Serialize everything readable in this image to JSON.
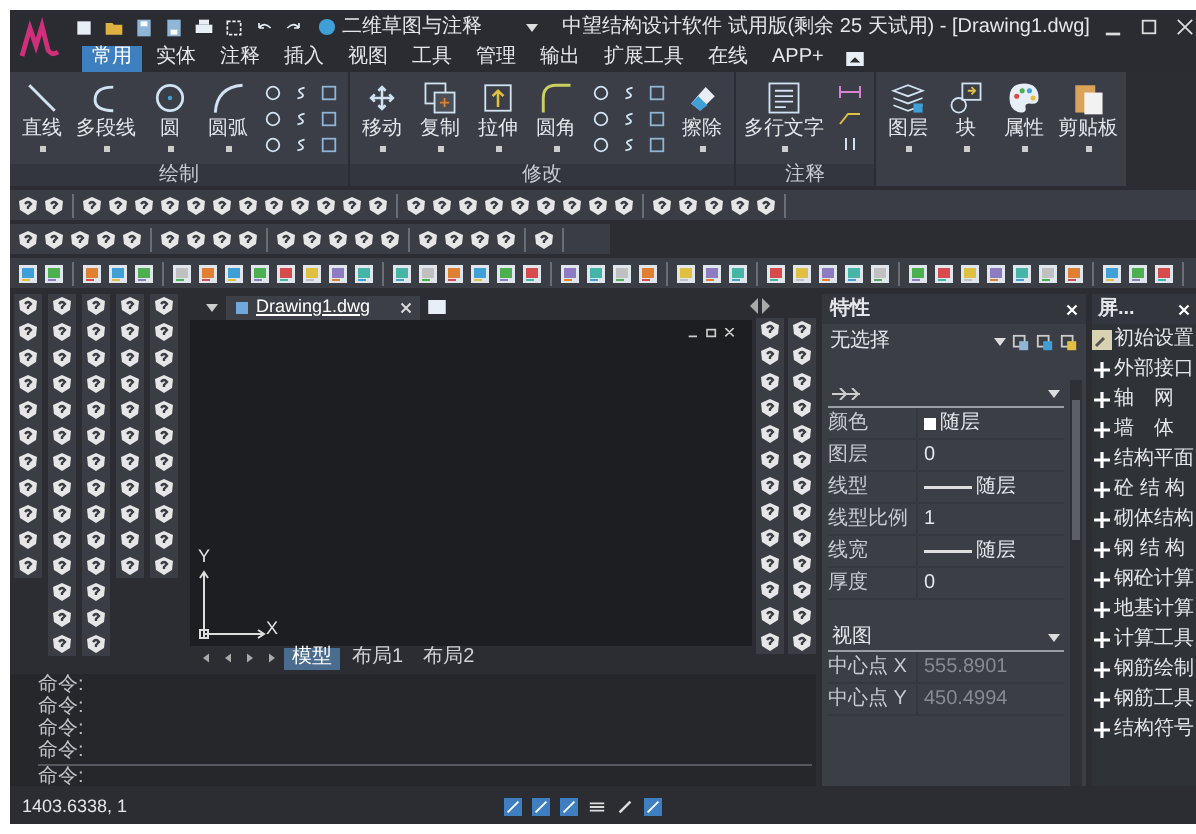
{
  "title_bar": {
    "workspace": "二维草图与注释",
    "title": "中望结构设计软件 试用版(剩余 25 天试用) - [Drawing1.dwg]"
  },
  "ribbon_tabs": [
    {
      "label": "常用",
      "selected": true
    },
    {
      "label": "实体",
      "selected": false
    },
    {
      "label": "注释",
      "selected": false
    },
    {
      "label": "插入",
      "selected": false
    },
    {
      "label": "视图",
      "selected": false
    },
    {
      "label": "工具",
      "selected": false
    },
    {
      "label": "管理",
      "selected": false
    },
    {
      "label": "输出",
      "selected": false
    },
    {
      "label": "扩展工具",
      "selected": false
    },
    {
      "label": "在线",
      "selected": false
    },
    {
      "label": "APP+",
      "selected": false
    }
  ],
  "ribbon_panels": [
    {
      "label": "绘制",
      "items": [
        {
          "kind": "large",
          "label": "直线"
        },
        {
          "kind": "large",
          "label": "多段线"
        },
        {
          "kind": "large",
          "label": "圆"
        },
        {
          "kind": "large",
          "label": "圆弧"
        },
        {
          "kind": "small_grid"
        }
      ]
    },
    {
      "label": "修改",
      "items": [
        {
          "kind": "large",
          "label": "移动"
        },
        {
          "kind": "large",
          "label": "复制"
        },
        {
          "kind": "large",
          "label": "拉伸"
        },
        {
          "kind": "large",
          "label": "圆角"
        },
        {
          "kind": "small_grid"
        },
        {
          "kind": "large",
          "label": "擦除"
        }
      ]
    },
    {
      "label": "注释",
      "items": [
        {
          "kind": "large",
          "label": "多行文字"
        },
        {
          "kind": "small_column"
        }
      ]
    },
    {
      "items": [
        {
          "kind": "large",
          "label": "图层"
        },
        {
          "kind": "large",
          "label": "块"
        },
        {
          "kind": "large",
          "label": "属性"
        },
        {
          "kind": "large",
          "label": "剪贴板"
        }
      ]
    }
  ],
  "drawing": {
    "tabs": [
      {
        "label": "Drawing1.dwg",
        "selected": true
      }
    ],
    "axis_x": "X",
    "axis_y": "Y",
    "layout_tabs": [
      {
        "label": "模型",
        "selected": true
      },
      {
        "label": "布局1",
        "selected": false
      },
      {
        "label": "布局2",
        "selected": false
      }
    ]
  },
  "command": {
    "history": [
      "命令:",
      "命令:",
      "命令:",
      "命令:"
    ],
    "prompt": "命令:"
  },
  "status_bar": {
    "coordinates": "1403.6338, 1"
  },
  "properties": {
    "title": "特性",
    "selection": "无选择",
    "sections": [
      {
        "rows": [
          {
            "name": "颜色",
            "value": "随层",
            "kind": "color",
            "disabled": false
          },
          {
            "name": "图层",
            "value": "0",
            "kind": "text",
            "disabled": false
          },
          {
            "name": "线型",
            "value": "随层",
            "kind": "line",
            "disabled": false
          },
          {
            "name": "线型比例",
            "value": "1",
            "kind": "text",
            "disabled": false
          },
          {
            "name": "线宽",
            "value": "随层",
            "kind": "line",
            "disabled": false
          },
          {
            "name": "厚度",
            "value": "0",
            "kind": "text",
            "disabled": false
          }
        ]
      },
      {
        "title": "视图",
        "rows": [
          {
            "name": "中心点 X",
            "value": "555.8901",
            "kind": "text",
            "disabled": true
          },
          {
            "name": "中心点 Y",
            "value": "450.4994",
            "kind": "text",
            "disabled": true
          }
        ]
      }
    ]
  },
  "screen_menu": {
    "title": "屏...",
    "items": [
      {
        "label": "初始设置",
        "kind": "settings"
      },
      {
        "label": "外部接口",
        "kind": "expand"
      },
      {
        "label": "轴　网",
        "kind": "expand"
      },
      {
        "label": "墙　体",
        "kind": "expand"
      },
      {
        "label": "结构平面",
        "kind": "expand"
      },
      {
        "label": "砼 结 构",
        "kind": "expand"
      },
      {
        "label": "砌体结构",
        "kind": "expand"
      },
      {
        "label": "钢 结 构",
        "kind": "expand"
      },
      {
        "label": "钢砼计算",
        "kind": "expand"
      },
      {
        "label": "地基计算",
        "kind": "expand"
      },
      {
        "label": "计算工具",
        "kind": "expand"
      },
      {
        "label": "钢筋绘制",
        "kind": "expand"
      },
      {
        "label": "钢筋工具",
        "kind": "expand"
      },
      {
        "label": "结构符号",
        "kind": "expand"
      }
    ]
  }
}
